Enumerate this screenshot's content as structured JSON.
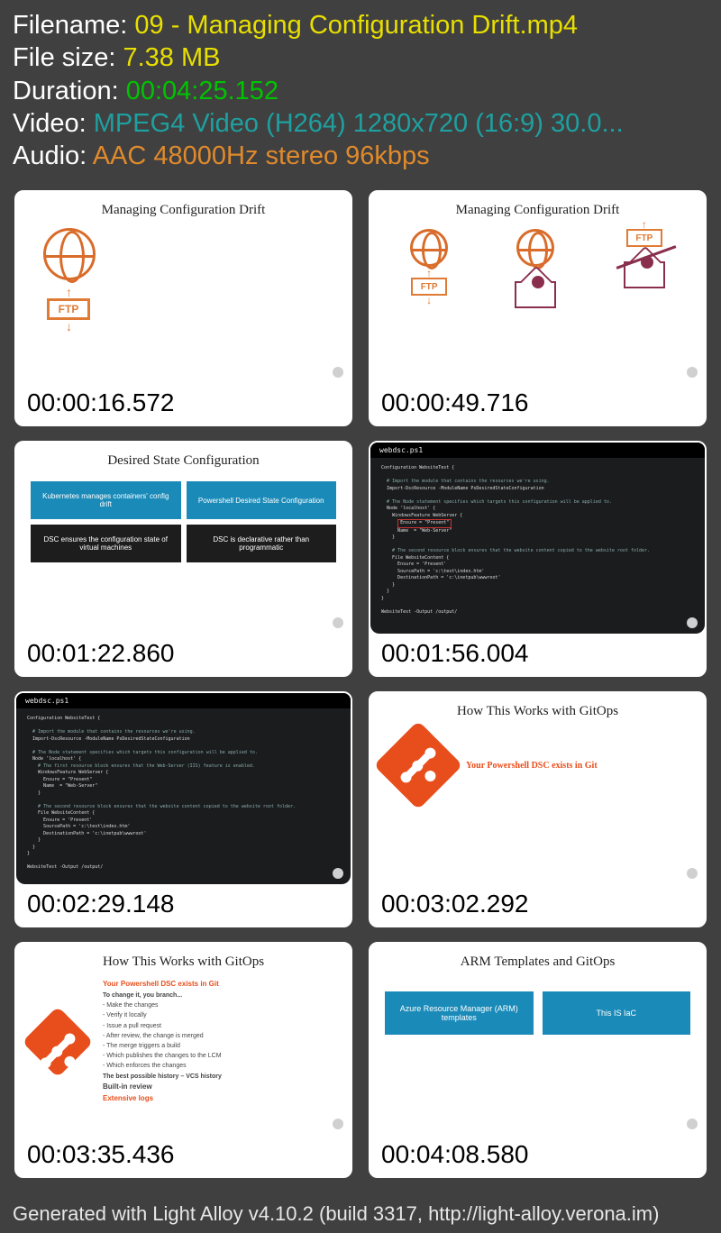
{
  "info": {
    "filename_label": "Filename: ",
    "filename_value": "09 - Managing Configuration Drift.mp4",
    "filesize_label": "File size: ",
    "filesize_value": "7.38 MB",
    "duration_label": "Duration: ",
    "duration_value": "00:04:25.152",
    "video_label": "Video: ",
    "video_value": "MPEG4 Video (H264) 1280x720 (16:9) 30.0...",
    "audio_label": "Audio: ",
    "audio_value": "AAC 48000Hz stereo 96kbps"
  },
  "slides": {
    "s1": {
      "title": "Managing Configuration Drift",
      "ftp": "FTP"
    },
    "s2": {
      "title": "Managing Configuration Drift",
      "ftp": "FTP"
    },
    "s3": {
      "title": "Desired State Configuration",
      "tiles": [
        "Kubernetes manages containers' config drift",
        "Powershell Desired State Configuration",
        "DSC ensures the configuration state of virtual machines",
        "DSC is declarative rather than programmatic"
      ]
    },
    "s4": {
      "filename": "webdsc.ps1",
      "code": "Configuration WebsiteTest {\n\n  # Import the module that contains the resources we're using.\n  Import-DscResource -ModuleName PsDesiredStateConfiguration\n\n  # The Node statement specifies which targets this configuration will be applied to.\n  Node 'localhost' {\n    WindowsFeature WebServer {\n      Ensure = \"Present\"\n      Name   = \"Web-Server\"\n    }\n\n    # The second resource block ensures that the website content copied to the website root folder.\n    File WebsiteContent {\n      Ensure = 'Present'\n      SourcePath = 'c:\\test\\index.htm'\n      DestinationPath = 'c:\\inetpub\\wwwroot'\n    }\n  }\n}\n\nWebsiteTest -Output /output/"
    },
    "s5": {
      "filename": "webdsc.ps1"
    },
    "s6": {
      "title": "How This Works with GitOps",
      "line1": "Your Powershell DSC exists in Git"
    },
    "s7": {
      "title": "How This Works with GitOps",
      "line1": "Your Powershell DSC exists in Git",
      "line2": "To change it, you branch...",
      "bullets": [
        "Make the changes",
        "Verify it locally",
        "Issue a pull request",
        "After review, the change is merged",
        "The merge triggers a build",
        "Which publishes the changes to the LCM",
        "Which enforces the changes"
      ],
      "line3": "The best possible history – VCS history",
      "line4": "Built-in review",
      "line5": "Extensive logs"
    },
    "s8": {
      "title": "ARM Templates and GitOps",
      "tile1": "Azure Resource Manager (ARM) templates",
      "tile2": "This IS IaC"
    }
  },
  "thumbnails": [
    {
      "time": "00:00:16.572"
    },
    {
      "time": "00:00:49.716"
    },
    {
      "time": "00:01:22.860"
    },
    {
      "time": "00:01:56.004"
    },
    {
      "time": "00:02:29.148"
    },
    {
      "time": "00:03:02.292"
    },
    {
      "time": "00:03:35.436"
    },
    {
      "time": "00:04:08.580"
    }
  ],
  "footer": "Generated with Light Alloy v4.10.2 (build 3317, http://light-alloy.verona.im)"
}
